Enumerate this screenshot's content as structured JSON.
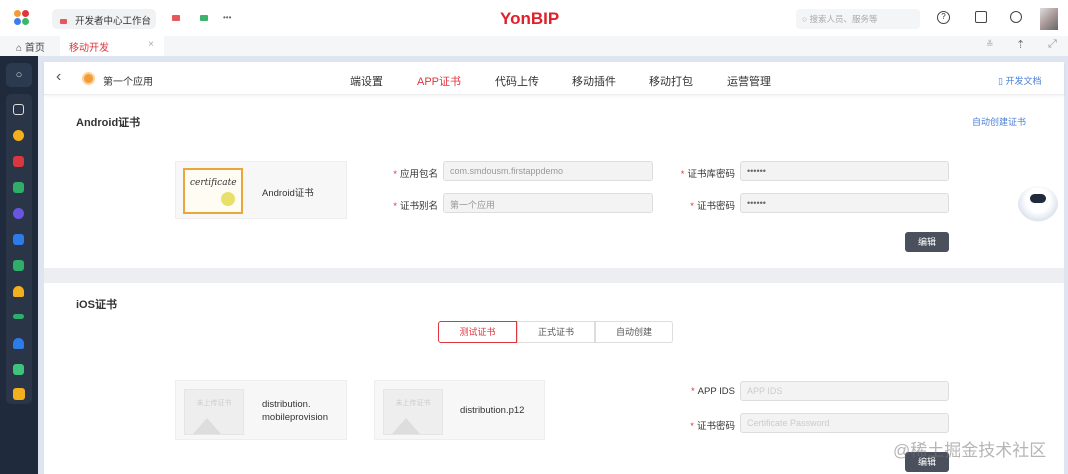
{
  "topbar": {
    "brand": "YonBIP",
    "tab1": "开发者中心工作台",
    "more": "•••",
    "search_placeholder": "搜索人员、服务等"
  },
  "tabs": {
    "home": "首页",
    "active": "移动开发",
    "close": "×"
  },
  "header": {
    "back": "‹",
    "app_name": "第一个应用",
    "nav": [
      "端设置",
      "APP证书",
      "代码上传",
      "移动插件",
      "移动打包",
      "运营管理"
    ],
    "docs": "开发文档"
  },
  "android": {
    "title": "Android证书",
    "auto_create": "自动创建证书",
    "cert_label": "Android证书",
    "cert_img_text": "certificate",
    "package_label": "应用包名",
    "package_value": "com.smdousm.firstappdemo",
    "alias_label": "证书别名",
    "alias_value": "第一个应用",
    "store_pwd_label": "证书库密码",
    "store_pwd_value": "••••••",
    "pwd_label": "证书密码",
    "pwd_value": "••••••",
    "edit": "编辑"
  },
  "ios": {
    "title": "iOS证书",
    "segments": [
      "测试证书",
      "正式证书",
      "自动创建"
    ],
    "file1": "distribution.\nmobileprovision",
    "file2": "distribution.p12",
    "placeholder_text": "未上传证书",
    "appids_label": "APP IDS",
    "appids_placeholder": "APP IDS",
    "pwd_label": "证书密码",
    "pwd_placeholder": "Certificate Password",
    "edit": "编辑"
  },
  "watermark": "@稀土掘金技术社区",
  "colors": {
    "accent": "#e0353d",
    "sidebar": "#1f2a3c"
  }
}
